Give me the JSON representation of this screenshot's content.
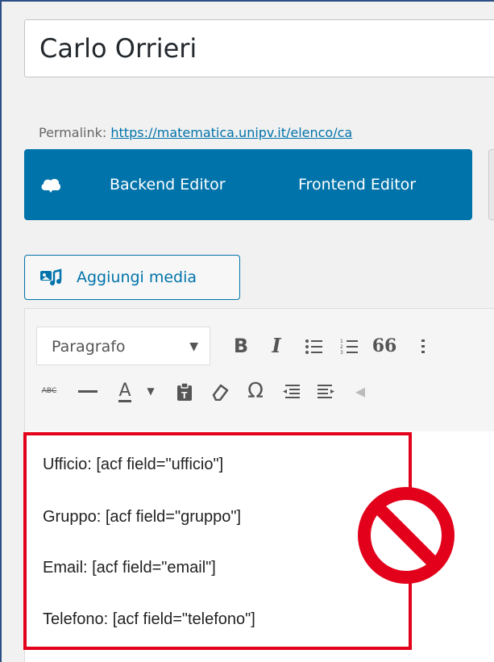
{
  "post": {
    "title": "Carlo Orrieri",
    "permalink_label": "Permalink:",
    "permalink_url": "https://matematica.unipv.it/elenco/ca"
  },
  "builder": {
    "backend_label": "Backend Editor",
    "frontend_label": "Frontend Editor",
    "logo_icon": "cloud-icon"
  },
  "media": {
    "label": "Aggiungi media",
    "icon": "media-icon"
  },
  "toolbar": {
    "format_value": "Paragrafo",
    "bold": "B",
    "italic": "I",
    "quote": "66",
    "strikethrough": "ABC",
    "text_color": "A",
    "omega": "Ω",
    "icons": [
      "bold-icon",
      "italic-icon",
      "bullet-list-icon",
      "numbered-list-icon",
      "blockquote-icon",
      "strikethrough-icon",
      "horizontal-line-icon",
      "text-color-icon",
      "paste-text-icon",
      "clear-formatting-icon",
      "special-character-icon",
      "outdent-icon",
      "indent-icon"
    ]
  },
  "content": {
    "lines": [
      "Ufficio: [acf field=\"ufficio\"]",
      "Gruppo: [acf field=\"gruppo\"]",
      "Email: [acf field=\"email\"]",
      "Telefono: [acf field=\"telefono\"]"
    ]
  },
  "colors": {
    "brand_blue": "#0073aa",
    "highlight_red": "#e2001a",
    "frame_blue": "#2e4f86"
  }
}
